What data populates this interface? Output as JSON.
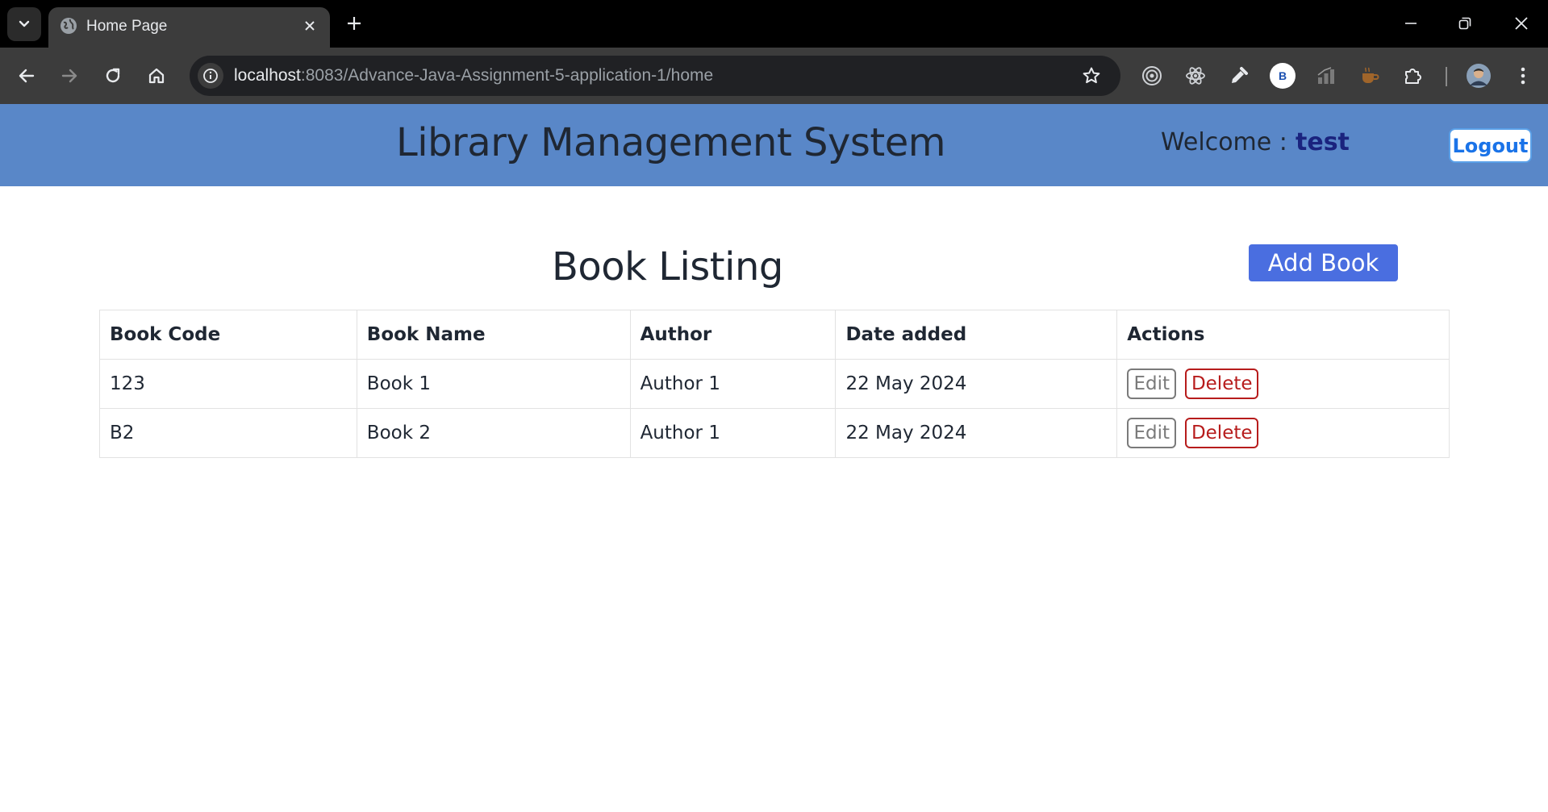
{
  "browser": {
    "tab_title": "Home Page",
    "url_host": "localhost",
    "url_rest": ":8083/Advance-Java-Assignment-5-application-1/home",
    "profile_extension_letter": "B"
  },
  "header": {
    "title": "Library Management System",
    "welcome_label": "Welcome :",
    "username": "test",
    "logout_label": "Logout",
    "background_color": "#5987c8"
  },
  "main": {
    "heading": "Book Listing",
    "add_book_label": "Add Book",
    "columns": [
      "Book Code",
      "Book Name",
      "Author",
      "Date added",
      "Actions"
    ],
    "rows": [
      {
        "code": "123",
        "name": "Book 1",
        "author": "Author 1",
        "date": "22 May 2024",
        "edit_label": "Edit",
        "delete_label": "Delete"
      },
      {
        "code": "B2",
        "name": "Book 2",
        "author": "Author 1",
        "date": "22 May 2024",
        "edit_label": "Edit",
        "delete_label": "Delete"
      }
    ]
  }
}
